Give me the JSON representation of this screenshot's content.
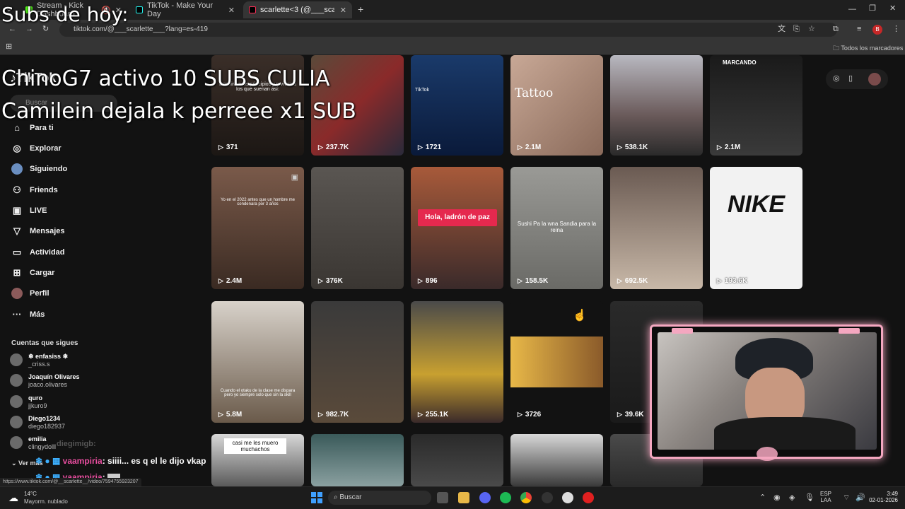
{
  "browser": {
    "tabs": [
      {
        "label": "Stream - Kick Dashboard",
        "active": false
      },
      {
        "label": "TikTok - Make Your Day",
        "active": false
      },
      {
        "label": "scarlette<3 (@___scarlette___)",
        "active": true
      }
    ],
    "new_tab": "+",
    "url": "tiktok.com/@___scarlette___?lang=es-419",
    "bookmarks_label": "Todos los marcadores",
    "status_url": "https://www.tiktok.com/@__scarlette__/video/7594755923207"
  },
  "sidebar": {
    "search_placeholder": "Buscar",
    "nav": [
      {
        "label": "Para ti",
        "icon": "home-icon"
      },
      {
        "label": "Explorar",
        "icon": "compass-icon"
      },
      {
        "label": "Siguiendo",
        "icon": "following-icon"
      },
      {
        "label": "Friends",
        "icon": "friends-icon"
      },
      {
        "label": "LIVE",
        "icon": "live-icon"
      },
      {
        "label": "Mensajes",
        "icon": "messages-icon"
      },
      {
        "label": "Actividad",
        "icon": "activity-icon"
      },
      {
        "label": "Cargar",
        "icon": "upload-icon"
      },
      {
        "label": "Perfil",
        "icon": "profile-icon"
      },
      {
        "label": "Más",
        "icon": "more-icon"
      }
    ],
    "following_title": "Cuentas que sigues",
    "accounts": [
      {
        "name": "❄ enfasiss ❄",
        "handle": "_criss.s"
      },
      {
        "name": "Joaquín Olivares",
        "handle": "joaco.olivares"
      },
      {
        "name": "quro",
        "handle": "jjkuro9"
      },
      {
        "name": "Diego1234",
        "handle": "diego182937"
      },
      {
        "name": "emilia",
        "handle": "clingydolll"
      }
    ],
    "see_more": "Ver más"
  },
  "videos": {
    "row1": [
      {
        "views": "371",
        "caption": "Dormirá a los principios y revivan a los que suenan así:"
      },
      {
        "views": "237.7K",
        "caption": ""
      },
      {
        "views": "1721",
        "caption": "TikTok"
      },
      {
        "views": "2.1M",
        "caption": "Tattoo"
      },
      {
        "views": "538.1K",
        "caption": ""
      },
      {
        "views": "2.1M",
        "caption": "MARCANDO"
      }
    ],
    "row2": [
      {
        "views": "2.4M",
        "caption": "Yo en el 2022 antes que un hombre me condenara por 3 años"
      },
      {
        "views": "376K",
        "caption": ""
      },
      {
        "views": "896",
        "caption": "Hola, ladrón de paz"
      },
      {
        "views": "158.5K",
        "caption": "Sushi Pa la wna Sandia para la reina"
      },
      {
        "views": "692.5K",
        "caption": ""
      },
      {
        "views": "193.6K",
        "caption": "NIKE"
      }
    ],
    "row3": [
      {
        "views": "5.8M",
        "caption": "Cuando el otaku de la clase me dispara pero yo siempre solo que sin la skill"
      },
      {
        "views": "982.7K",
        "caption": ""
      },
      {
        "views": "255.1K",
        "caption": ""
      },
      {
        "views": "3726",
        "caption": ""
      },
      {
        "views": "39.6K",
        "caption": ""
      }
    ],
    "row4_caption": "casi me les muero muchachos"
  },
  "stream_overlay": {
    "subs_title": "Subs de hoy:",
    "sub_line1": "ChinoG7 activo 10 SUBS CULIA",
    "sub_line2": "Camilein dejala k perreee x1 SUB",
    "chat": [
      {
        "user": "diegimigb",
        "text": ":"
      },
      {
        "user": "vaampiria",
        "text": ": siiii... es q el le dijo vkap"
      },
      {
        "user": "vaampiria",
        "text": ":"
      }
    ]
  },
  "taskbar": {
    "weather_temp": "14°C",
    "weather_desc": "Mayorm. nublado",
    "search": "Buscar",
    "lang1": "ESP",
    "lang2": "LAA",
    "time": "3:49",
    "date": "02-01-2026"
  },
  "colors": {
    "accent": "#fe2c55",
    "webcam_frame": "#f4a7c0"
  }
}
